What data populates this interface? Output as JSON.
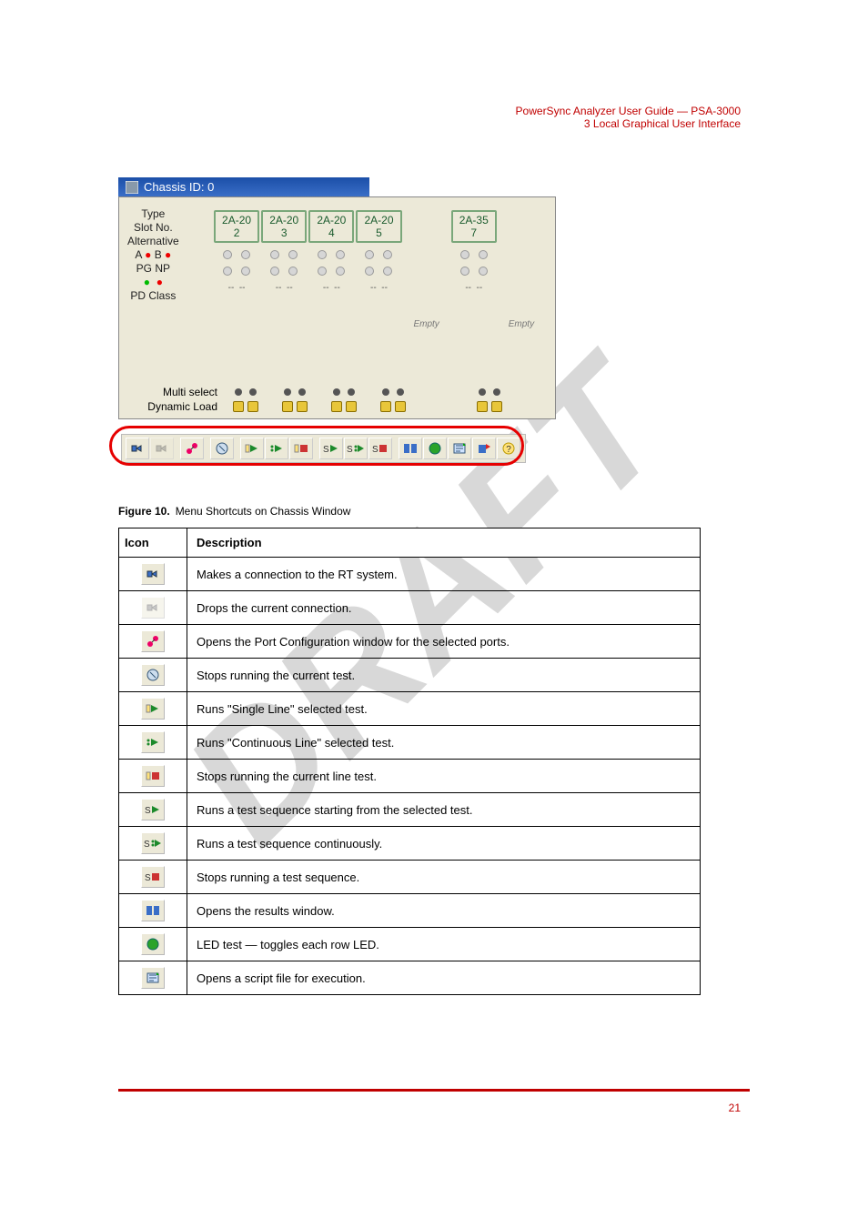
{
  "header": {
    "doc_title": "PowerSync Analyzer User Guide — PSA-3000",
    "section": "3  Local Graphical User Interface"
  },
  "window_title": "Chassis ID: 0",
  "row_labels": {
    "type": "Type",
    "slot": "Slot No.",
    "alt": "Alternative",
    "ab": "A     B",
    "pgnp": "PG NP",
    "pdc": "PD Class",
    "multi": "Multi select",
    "dyn": "Dynamic Load"
  },
  "slots": [
    {
      "type": "2A-20",
      "no": "2",
      "empty": false
    },
    {
      "type": "2A-20",
      "no": "3",
      "empty": false
    },
    {
      "type": "2A-20",
      "no": "4",
      "empty": false
    },
    {
      "type": "2A-20",
      "no": "5",
      "empty": false
    },
    {
      "type": "",
      "no": "",
      "empty": true,
      "label": "Empty"
    },
    {
      "type": "2A-35",
      "no": "7",
      "empty": false
    },
    {
      "type": "",
      "no": "",
      "empty": true,
      "label": "Empty"
    }
  ],
  "toolbar": [
    {
      "name": "connect",
      "desc": "Makes a connection to the RT system."
    },
    {
      "name": "disconnect",
      "desc": "Drops the current connection."
    },
    {
      "name": "port-config",
      "desc": "Opens the Port Configuration window for the selected ports."
    },
    {
      "name": "stop-test",
      "desc": "Stops running the current test."
    },
    {
      "name": "run-line",
      "desc": "Runs \"Single Line\" selected test."
    },
    {
      "name": "run-cont",
      "desc": "Runs \"Continuous Line\" selected test."
    },
    {
      "name": "stop-line",
      "desc": "Stops running the current line test."
    },
    {
      "name": "sequence-run",
      "desc": "Runs a test sequence starting from the selected test."
    },
    {
      "name": "sequence-cont",
      "desc": "Runs a test sequence continuously."
    },
    {
      "name": "sequence-stop",
      "desc": "Stops running a test sequence."
    },
    {
      "name": "show-results",
      "desc": "Opens the results window."
    },
    {
      "name": "led-control",
      "desc": "LED test — toggles each row LED."
    },
    {
      "name": "open-script",
      "desc": "Opens a script file for execution."
    }
  ],
  "caption": {
    "no": "Figure 10.",
    "text": "Menu Shortcuts on Chassis Window"
  },
  "table_header": {
    "icon": "Icon",
    "desc": "Description"
  },
  "page_no": "21"
}
